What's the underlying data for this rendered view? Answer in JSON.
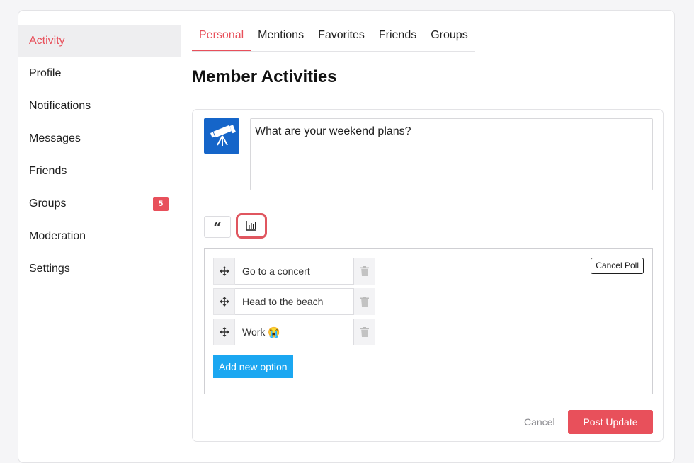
{
  "sidebar": {
    "items": [
      {
        "label": "Activity",
        "active": true
      },
      {
        "label": "Profile"
      },
      {
        "label": "Notifications"
      },
      {
        "label": "Messages"
      },
      {
        "label": "Friends"
      },
      {
        "label": "Groups",
        "badge": "5"
      },
      {
        "label": "Moderation"
      },
      {
        "label": "Settings"
      }
    ]
  },
  "tabs": [
    {
      "label": "Personal",
      "active": true
    },
    {
      "label": "Mentions"
    },
    {
      "label": "Favorites"
    },
    {
      "label": "Friends"
    },
    {
      "label": "Groups"
    }
  ],
  "page": {
    "title": "Member Activities"
  },
  "composer": {
    "avatar_icon": "telescope-icon",
    "text": "What are your weekend plans?",
    "tools": {
      "quote_icon": "quote-icon",
      "quote_glyph": "“",
      "poll_icon": "poll-chart-icon"
    },
    "poll": {
      "cancel_label": "Cancel Poll",
      "options": [
        {
          "text": "Go to a concert"
        },
        {
          "text": "Head to the beach"
        },
        {
          "text": "Work 😭"
        }
      ],
      "add_label": "Add new option"
    },
    "cancel_label": "Cancel",
    "post_label": "Post Update"
  },
  "colors": {
    "accent": "#e8505b",
    "primary_blue": "#1ba7f1",
    "avatar_bg": "#1565c9"
  }
}
